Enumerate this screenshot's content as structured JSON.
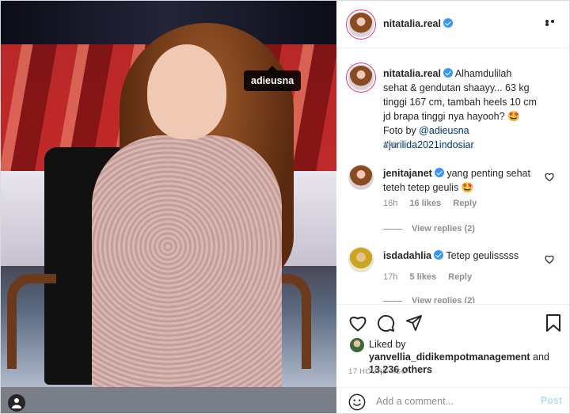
{
  "photo": {
    "tag_label": "adieusna"
  },
  "header": {
    "username": "nitatalia.real"
  },
  "caption": {
    "username": "nitatalia.real",
    "text": "Alhamdulilah sehat & gendutan shaayy... 63 kg tinggi 167 cm, tambah heels 10 cm jd brapa tinggi nya hayooh? 🤩 Foto by",
    "mention": "@adieusna",
    "hashtag": "#jurilida2021indosiar",
    "time": "17h"
  },
  "comments": [
    {
      "username": "jenitajanet",
      "text": "yang penting sehat teteh tetep geulis 🤩",
      "time": "16h",
      "likes": "16 likes",
      "reply": "Reply",
      "view_replies": "View replies (2)"
    },
    {
      "username": "isdadahlia",
      "text": "Tetep geulisssss",
      "time": "17h",
      "likes": "5 likes",
      "reply": "Reply",
      "view_replies": "View replies (2)"
    }
  ],
  "likes": {
    "prefix": "Liked by",
    "user": "yanvellia_didikempotmanagement",
    "and": "and",
    "others": "13,236 others"
  },
  "time_ago": "17 HOURS AGO",
  "add_comment": {
    "placeholder": "Add a comment...",
    "post_label": "Post"
  },
  "colors": {
    "verified": "#3897f0",
    "link": "#00376b",
    "post_disabled": "#b2dffc"
  },
  "icons": [
    "heart-icon",
    "comment-icon",
    "share-icon",
    "bookmark-icon",
    "smile-icon",
    "more-icon",
    "user-tag-icon"
  ]
}
